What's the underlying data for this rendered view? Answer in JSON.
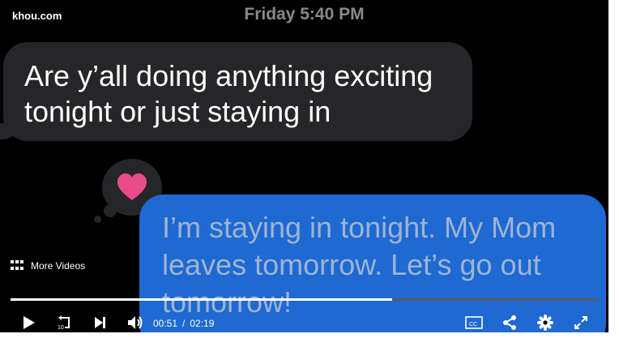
{
  "watermark": "khou.com",
  "timestamp": "Friday 5:40 PM",
  "messages": {
    "received": "Are y’all doing anything exciting tonight or just staying in",
    "sent": "I’m staying in tonight. My Mom leaves tomorrow. Let’s go out tomorrow!"
  },
  "reaction": {
    "icon": "heart-icon",
    "color": "#ea4c89"
  },
  "more_videos": {
    "label": "More Videos",
    "icon": "grid-icon"
  },
  "player": {
    "current_time": "00:51",
    "separator": "/",
    "duration": "02:19",
    "buffered_fraction": 1.0,
    "played_fraction": 0.65,
    "controls": [
      "play-icon",
      "replay-10-icon",
      "next-icon",
      "volume-icon",
      "captions-icon",
      "share-icon",
      "settings-icon",
      "fullscreen-icon"
    ]
  },
  "colors": {
    "sent_bubble": "#1e69d2",
    "received_bubble": "#262629",
    "background": "#000000"
  }
}
